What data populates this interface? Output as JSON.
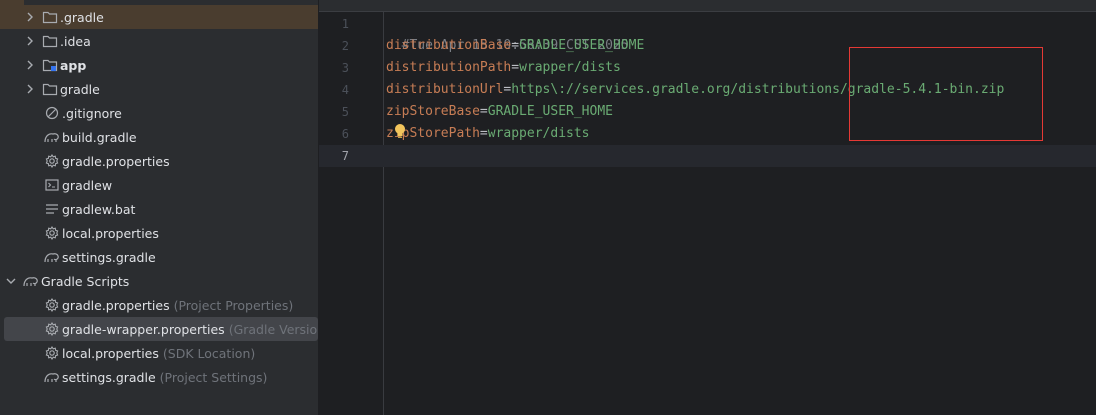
{
  "tree": {
    "items": [
      {
        "label": ".gradle",
        "hint": "",
        "bold": false,
        "icon": "folder-icon",
        "chevron": "right"
      },
      {
        "label": ".idea",
        "hint": "",
        "bold": false,
        "icon": "folder-icon",
        "chevron": "right"
      },
      {
        "label": "app",
        "hint": "",
        "bold": true,
        "icon": "module-folder-icon",
        "chevron": "right"
      },
      {
        "label": "gradle",
        "hint": "",
        "bold": false,
        "icon": "folder-icon",
        "chevron": "right"
      },
      {
        "label": ".gitignore",
        "hint": "",
        "bold": false,
        "icon": "ignore-file-icon",
        "chevron": ""
      },
      {
        "label": "build.gradle",
        "hint": "",
        "bold": false,
        "icon": "gradle-icon",
        "chevron": ""
      },
      {
        "label": "gradle.properties",
        "hint": "",
        "bold": false,
        "icon": "gear-icon",
        "chevron": ""
      },
      {
        "label": "gradlew",
        "hint": "",
        "bold": false,
        "icon": "terminal-icon",
        "chevron": ""
      },
      {
        "label": "gradlew.bat",
        "hint": "",
        "bold": false,
        "icon": "text-file-icon",
        "chevron": ""
      },
      {
        "label": "local.properties",
        "hint": "",
        "bold": false,
        "icon": "gear-icon",
        "chevron": ""
      },
      {
        "label": "settings.gradle",
        "hint": "",
        "bold": false,
        "icon": "gradle-icon",
        "chevron": ""
      },
      {
        "label": "Gradle Scripts",
        "hint": "",
        "bold": false,
        "icon": "gradle-icon",
        "chevron": "down"
      },
      {
        "label": "gradle.properties",
        "hint": "(Project Properties)",
        "bold": false,
        "icon": "gear-icon",
        "chevron": ""
      },
      {
        "label": "gradle-wrapper.properties",
        "hint": "(Gradle Version)",
        "bold": false,
        "icon": "gear-icon",
        "chevron": ""
      },
      {
        "label": "local.properties",
        "hint": "(SDK Location)",
        "bold": false,
        "icon": "gear-icon",
        "chevron": ""
      },
      {
        "label": "settings.gradle",
        "hint": "(Project Settings)",
        "bold": false,
        "icon": "gradle-icon",
        "chevron": ""
      }
    ]
  },
  "editor": {
    "current_line": "7",
    "lines": [
      {
        "n": "1",
        "comment": "#Tue Apr 15 10:56:39 CST 2025",
        "key": "",
        "eq": "",
        "val": ""
      },
      {
        "n": "2",
        "comment": "",
        "key": "distributionBase",
        "eq": "=",
        "val": "GRADLE_USER_HOME"
      },
      {
        "n": "3",
        "comment": "",
        "key": "distributionPath",
        "eq": "=",
        "val": "wrapper/dists"
      },
      {
        "n": "4",
        "comment": "",
        "key": "distributionUrl",
        "eq": "=",
        "val": "https\\://services.gradle.org/distributions/gradle-5.4.1-bin.zip"
      },
      {
        "n": "5",
        "comment": "",
        "key": "zipStoreBase",
        "eq": "=",
        "val": "GRADLE_USER_HOME"
      },
      {
        "n": "6",
        "comment": "",
        "key": "zipStorePath",
        "eq": "=",
        "val": "wrapper/dists"
      },
      {
        "n": "7",
        "comment": "",
        "key": "",
        "eq": "",
        "val": ""
      }
    ]
  },
  "colors": {
    "accent_highlight_box": "#e53935",
    "key": "#c77d55",
    "value": "#6aab73",
    "comment": "#7a7e85"
  }
}
